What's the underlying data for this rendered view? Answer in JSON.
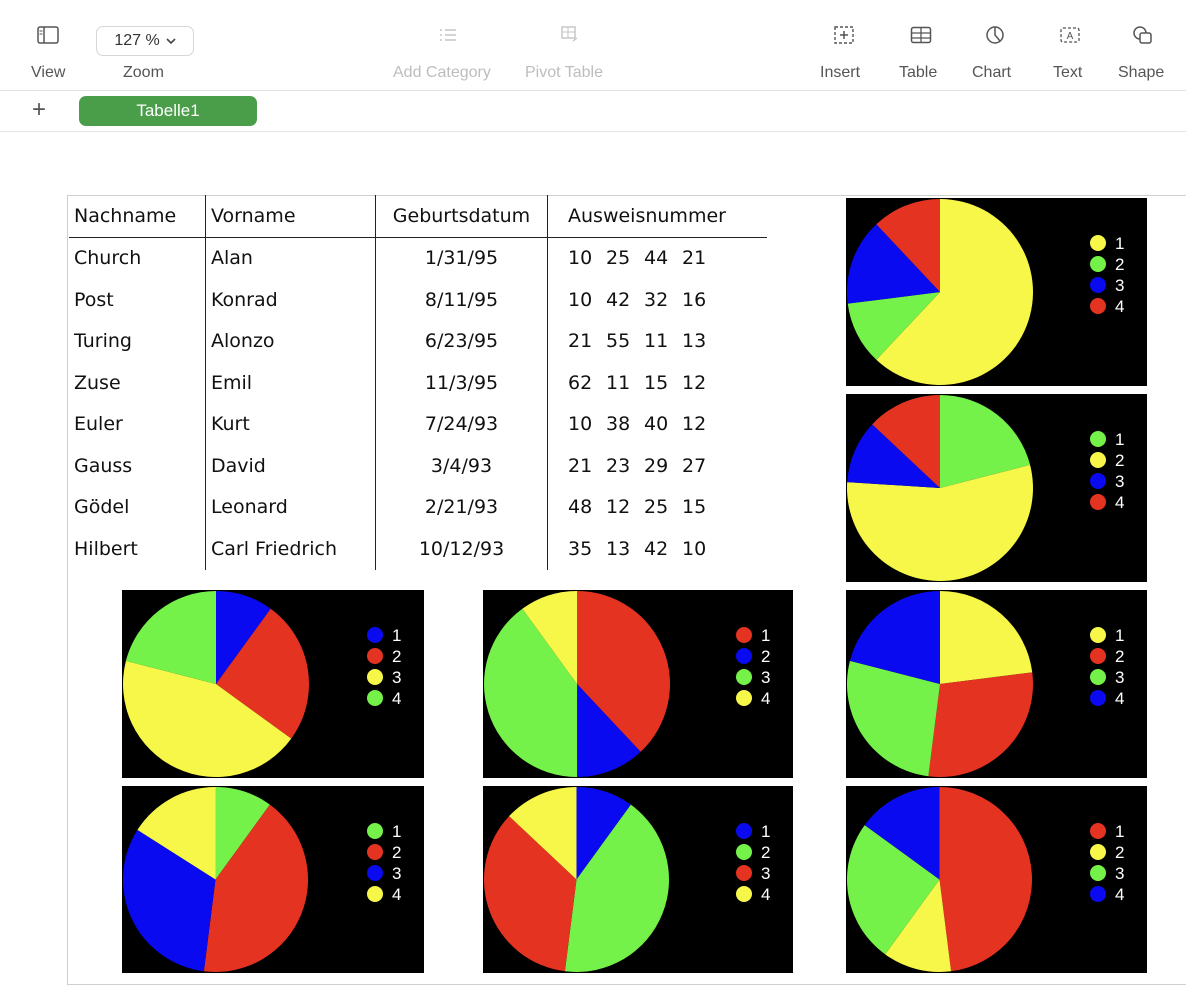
{
  "toolbar": {
    "view_label": "View",
    "zoom_value": "127 %",
    "zoom_label": "Zoom",
    "add_category_label": "Add Category",
    "pivot_table_label": "Pivot Table",
    "insert_label": "Insert",
    "table_label": "Table",
    "chart_label": "Chart",
    "text_label": "Text",
    "shape_label": "Shape"
  },
  "sheets": {
    "add_label": "+",
    "active_tab": "Tabelle1"
  },
  "table": {
    "headers": [
      "Nachname",
      "Vorname",
      "Geburtsdatum",
      "Ausweisnummer"
    ],
    "rows": [
      {
        "nachname": "Church",
        "vorname": "Alan",
        "geburtsdatum": "1/31/95",
        "ausweis": [
          "10",
          "25",
          "44",
          "21"
        ]
      },
      {
        "nachname": "Post",
        "vorname": "Konrad",
        "geburtsdatum": "8/11/95",
        "ausweis": [
          "10",
          "42",
          "32",
          "16"
        ]
      },
      {
        "nachname": "Turing",
        "vorname": "Alonzo",
        "geburtsdatum": "6/23/95",
        "ausweis": [
          "21",
          "55",
          "11",
          "13"
        ]
      },
      {
        "nachname": "Zuse",
        "vorname": "Emil",
        "geburtsdatum": "11/3/95",
        "ausweis": [
          "62",
          "11",
          "15",
          "12"
        ]
      },
      {
        "nachname": "Euler",
        "vorname": "Kurt",
        "geburtsdatum": "7/24/93",
        "ausweis": [
          "10",
          "38",
          "40",
          "12"
        ]
      },
      {
        "nachname": "Gauss",
        "vorname": "David",
        "geburtsdatum": "3/4/93",
        "ausweis": [
          "21",
          "23",
          "29",
          "27"
        ]
      },
      {
        "nachname": "Gödel",
        "vorname": "Leonard",
        "geburtsdatum": "2/21/93",
        "ausweis": [
          "48",
          "12",
          "25",
          "15"
        ]
      },
      {
        "nachname": "Hilbert",
        "vorname": "Carl Friedrich",
        "geburtsdatum": "10/12/93",
        "ausweis": [
          "35",
          "13",
          "42",
          "10"
        ]
      }
    ]
  },
  "colors": {
    "yellow": "#f7f74a",
    "green": "#74f24a",
    "blue": "#0a0af0",
    "red": "#e53322",
    "chart_bg": "#000000",
    "tab_green": "#4a9e4a"
  },
  "chart_data": [
    {
      "type": "pie",
      "categories": [
        "1",
        "2",
        "3",
        "4"
      ],
      "values": [
        62,
        11,
        15,
        12
      ],
      "colors": [
        "#f7f74a",
        "#74f24a",
        "#0a0af0",
        "#e53322"
      ]
    },
    {
      "type": "pie",
      "categories": [
        "1",
        "2",
        "3",
        "4"
      ],
      "values": [
        21,
        55,
        11,
        13
      ],
      "colors": [
        "#74f24a",
        "#f7f74a",
        "#0a0af0",
        "#e53322"
      ]
    },
    {
      "type": "pie",
      "categories": [
        "1",
        "2",
        "3",
        "4"
      ],
      "values": [
        10,
        25,
        44,
        21
      ],
      "colors": [
        "#0a0af0",
        "#e53322",
        "#f7f74a",
        "#74f24a"
      ]
    },
    {
      "type": "pie",
      "categories": [
        "1",
        "2",
        "3",
        "4"
      ],
      "values": [
        38,
        12,
        40,
        10
      ],
      "colors": [
        "#e53322",
        "#0a0af0",
        "#74f24a",
        "#f7f74a"
      ]
    },
    {
      "type": "pie",
      "categories": [
        "1",
        "2",
        "3",
        "4"
      ],
      "values": [
        23,
        29,
        27,
        21
      ],
      "colors": [
        "#f7f74a",
        "#e53322",
        "#74f24a",
        "#0a0af0"
      ]
    },
    {
      "type": "pie",
      "categories": [
        "1",
        "2",
        "3",
        "4"
      ],
      "values": [
        10,
        42,
        32,
        16
      ],
      "colors": [
        "#74f24a",
        "#e53322",
        "#0a0af0",
        "#f7f74a"
      ]
    },
    {
      "type": "pie",
      "categories": [
        "1",
        "2",
        "3",
        "4"
      ],
      "values": [
        10,
        42,
        35,
        13
      ],
      "colors": [
        "#0a0af0",
        "#74f24a",
        "#e53322",
        "#f7f74a"
      ]
    },
    {
      "type": "pie",
      "categories": [
        "1",
        "2",
        "3",
        "4"
      ],
      "values": [
        48,
        12,
        25,
        15
      ],
      "colors": [
        "#e53322",
        "#f7f74a",
        "#74f24a",
        "#0a0af0"
      ]
    }
  ]
}
